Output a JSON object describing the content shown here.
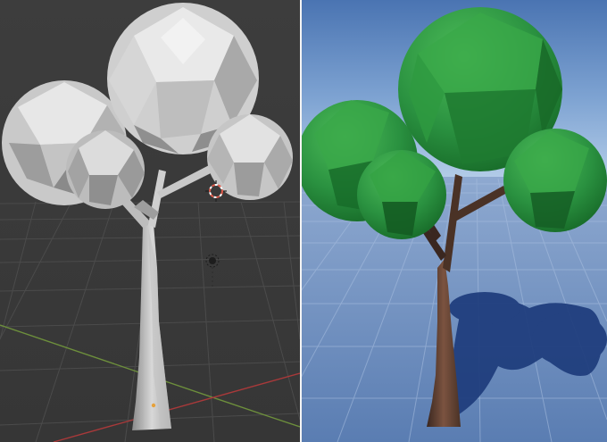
{
  "panels": [
    {
      "name": "blender-viewport-untextured",
      "accent": "#3a3a3a"
    },
    {
      "name": "game-engine-textured-render",
      "accent": "#5f83b8"
    }
  ],
  "colors": {
    "viewport_bg": "#3a3a3a",
    "grid_line": "#4a4a4a",
    "x_axis": "#b03a3a",
    "y_axis": "#6f9a3a",
    "mesh_light": "#e4e4e4",
    "mesh_mid": "#b9b9b9",
    "mesh_dark": "#7d7d7d",
    "sky_top": "#4f79b8",
    "sky_horizon": "#a9c4e2",
    "floor": "#5d80b5",
    "floor_line": "#7f9dcb",
    "leaf_light": "#3eae4a",
    "leaf_mid": "#25893a",
    "leaf_dark": "#145c22",
    "trunk": "#5a3a2c",
    "trunk_dark": "#3a2720",
    "shadow": "#1f3a78"
  },
  "icons": [
    "3d-cursor-icon",
    "object-origin-icon",
    "light-empty-icon"
  ]
}
